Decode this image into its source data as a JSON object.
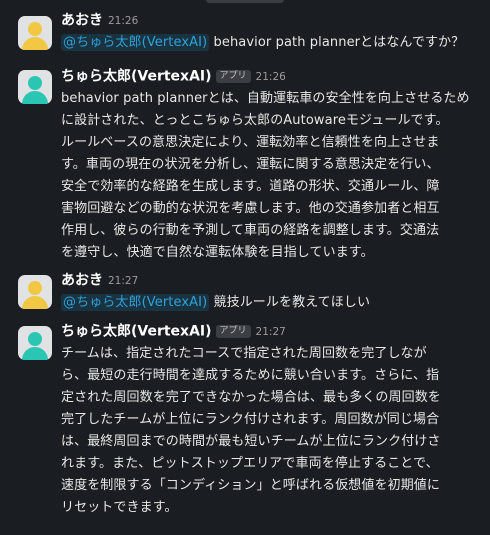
{
  "colors": {
    "background": "#1a1d21",
    "mention_text": "#2fa0d8",
    "user_avatar": "#f2c744",
    "bot_avatar": "#2bc5b4"
  },
  "messages": [
    {
      "sender": "あおき",
      "time": "21:26",
      "avatar_icon": "user-avatar-icon",
      "mention": "@ちゅら太郎(VertexAI)",
      "text": " behavior path plannerとはなんですか？"
    },
    {
      "sender": "ちゅら太郎(VertexAI)",
      "badge": "アプリ",
      "time": "21:26",
      "avatar_icon": "bot-avatar-icon",
      "lines": [
        "behavior path plannerとは、自動運転車の安全性を向上させるため",
        "に設計された、とっとこちゅら太郎のAutowareモジュールです。",
        "ルールベースの意思決定により、運転効率と信頼性を向上させま",
        "す。車両の現在の状況を分析し、運転に関する意思決定を行い、",
        "安全で効率的な経路を生成します。道路の形状、交通ルール、障",
        "害物回避などの動的な状況を考慮します。他の交通参加者と相互",
        "作用し、彼らの行動を予測して車両の経路を調整します。交通法",
        "を遵守し、快適で自然な運転体験を目指しています。"
      ]
    },
    {
      "sender": "あおき",
      "time": "21:27",
      "avatar_icon": "user-avatar-icon",
      "mention": "@ちゅら太郎(VertexAI)",
      "text": " 競技ルールを教えてほしい"
    },
    {
      "sender": "ちゅら太郎(VertexAI)",
      "badge": "アプリ",
      "time": "21:27",
      "avatar_icon": "bot-avatar-icon",
      "lines": [
        "チームは、指定されたコースで指定された周回数を完了しなが",
        "ら、最短の走行時間を達成するために競い合います。さらに、指",
        "定された周回数を完了できなかった場合は、最も多くの周回数を",
        "完了したチームが上位にランク付けされます。周回数が同じ場合",
        "は、最終周回までの時間が最も短いチームが上位にランク付けさ",
        "れます。また、ピットストップエリアで車両を停止することで、",
        "速度を制限する「コンディション」と呼ばれる仮想値を初期値に",
        "リセットできます。"
      ]
    }
  ]
}
